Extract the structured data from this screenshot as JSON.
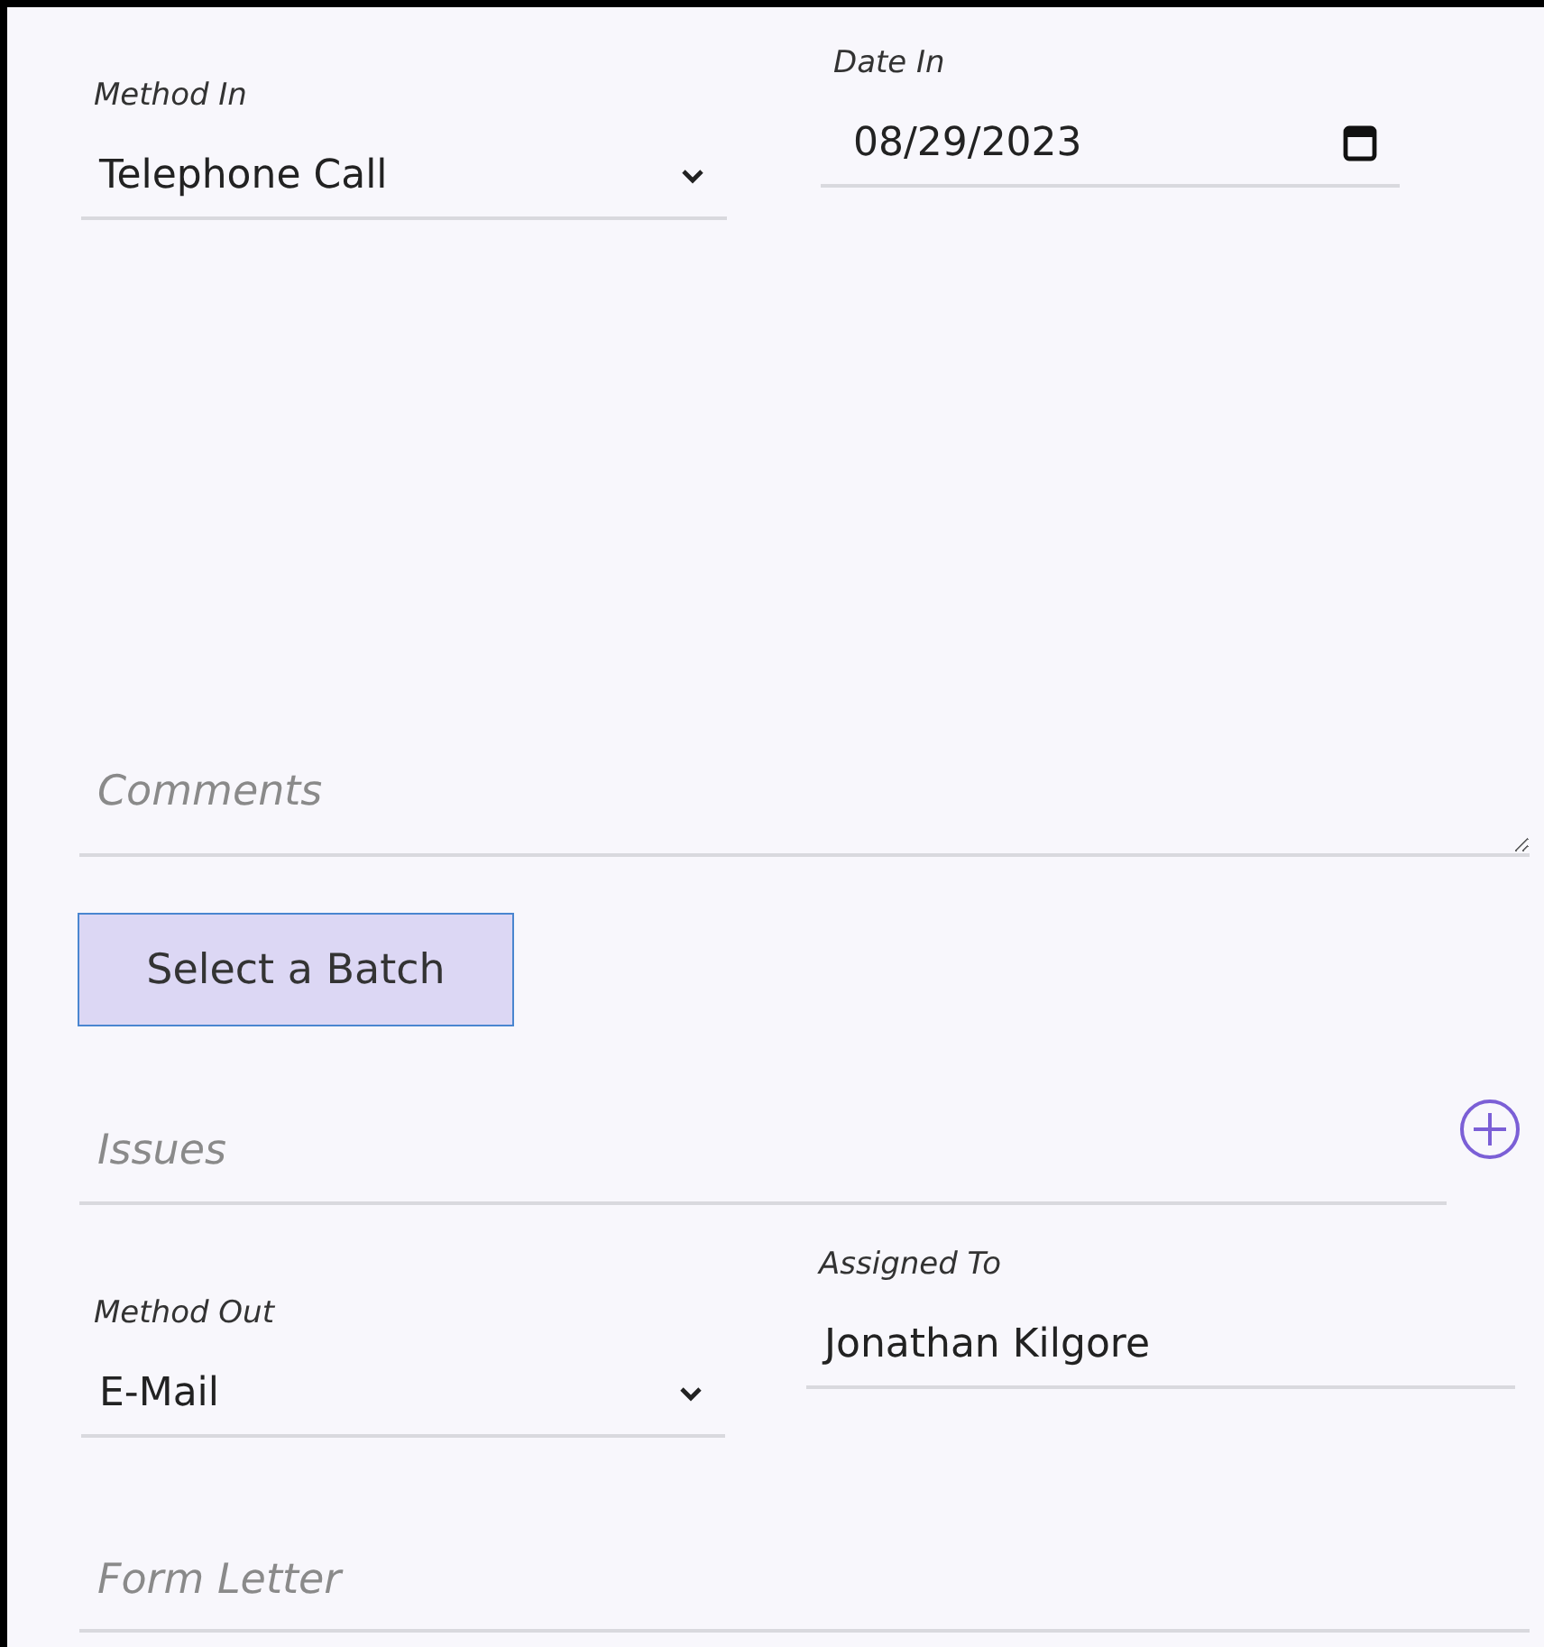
{
  "method_in": {
    "label": "Method In",
    "value": "Telephone Call"
  },
  "date_in": {
    "label": "Date In",
    "value": "08/29/2023"
  },
  "comments": {
    "placeholder": "Comments"
  },
  "batch_button": {
    "label": "Select a Batch"
  },
  "issues": {
    "placeholder": "Issues"
  },
  "method_out": {
    "label": "Method Out",
    "value": "E-Mail"
  },
  "assigned_to": {
    "label": "Assigned To",
    "value": "Jonathan Kilgore"
  },
  "form_letter": {
    "placeholder": "Form Letter"
  }
}
